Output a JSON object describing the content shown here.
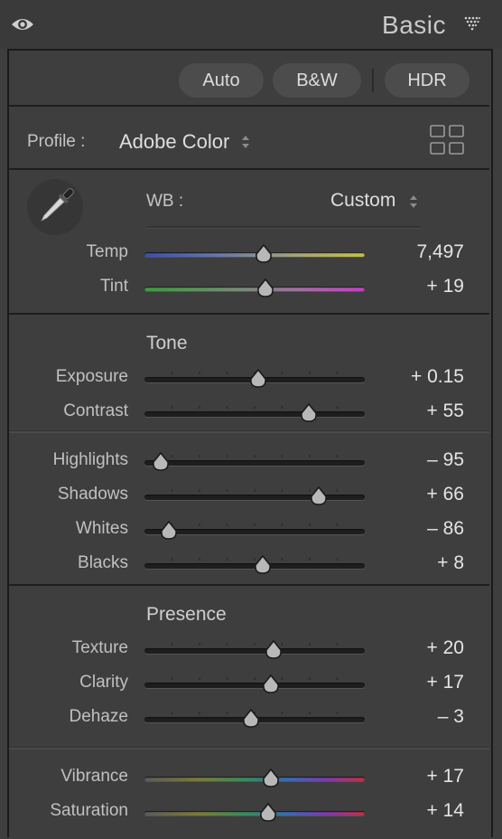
{
  "header": {
    "title": "Basic",
    "eye_icon": "eye-icon",
    "collapse_icon": "triangle-dots-icon"
  },
  "treatment": {
    "auto": "Auto",
    "bw": "B&W",
    "hdr": "HDR"
  },
  "profile": {
    "label": "Profile :",
    "value": "Adobe Color",
    "browser_icon": "grid-icon"
  },
  "wb": {
    "label": "WB :",
    "value": "Custom",
    "eyedropper_icon": "eyedropper-icon"
  },
  "sections": {
    "tone": "Tone",
    "presence": "Presence"
  },
  "sliders": [
    {
      "id": "temp",
      "label": "Temp",
      "value": "7,497",
      "pos": 0.54,
      "track": "temp"
    },
    {
      "id": "tint",
      "label": "Tint",
      "value": "+ 19",
      "pos": 0.55,
      "track": "tint"
    },
    {
      "id": "exposure",
      "label": "Exposure",
      "value": "+ 0.15",
      "pos": 0.515,
      "track": "plain"
    },
    {
      "id": "contrast",
      "label": "Contrast",
      "value": "+ 55",
      "pos": 0.745,
      "track": "plain"
    },
    {
      "id": "highlights",
      "label": "Highlights",
      "value": "– 95",
      "pos": 0.075,
      "track": "plain"
    },
    {
      "id": "shadows",
      "label": "Shadows",
      "value": "+ 66",
      "pos": 0.79,
      "track": "plain"
    },
    {
      "id": "whites",
      "label": "Whites",
      "value": "– 86",
      "pos": 0.11,
      "track": "plain"
    },
    {
      "id": "blacks",
      "label": "Blacks",
      "value": "+ 8",
      "pos": 0.535,
      "track": "plain"
    },
    {
      "id": "texture",
      "label": "Texture",
      "value": "+ 20",
      "pos": 0.585,
      "track": "plain"
    },
    {
      "id": "clarity",
      "label": "Clarity",
      "value": "+ 17",
      "pos": 0.575,
      "track": "plain"
    },
    {
      "id": "dehaze",
      "label": "Dehaze",
      "value": "– 3",
      "pos": 0.485,
      "track": "plain"
    },
    {
      "id": "vibrance",
      "label": "Vibrance",
      "value": "+ 17",
      "pos": 0.575,
      "track": "hue"
    },
    {
      "id": "saturation",
      "label": "Saturation",
      "value": "+ 14",
      "pos": 0.56,
      "track": "hue"
    }
  ],
  "colors": {
    "panel": "#3e3e3e",
    "border": "#1a1a1a",
    "pill": "#4c4c4c"
  }
}
